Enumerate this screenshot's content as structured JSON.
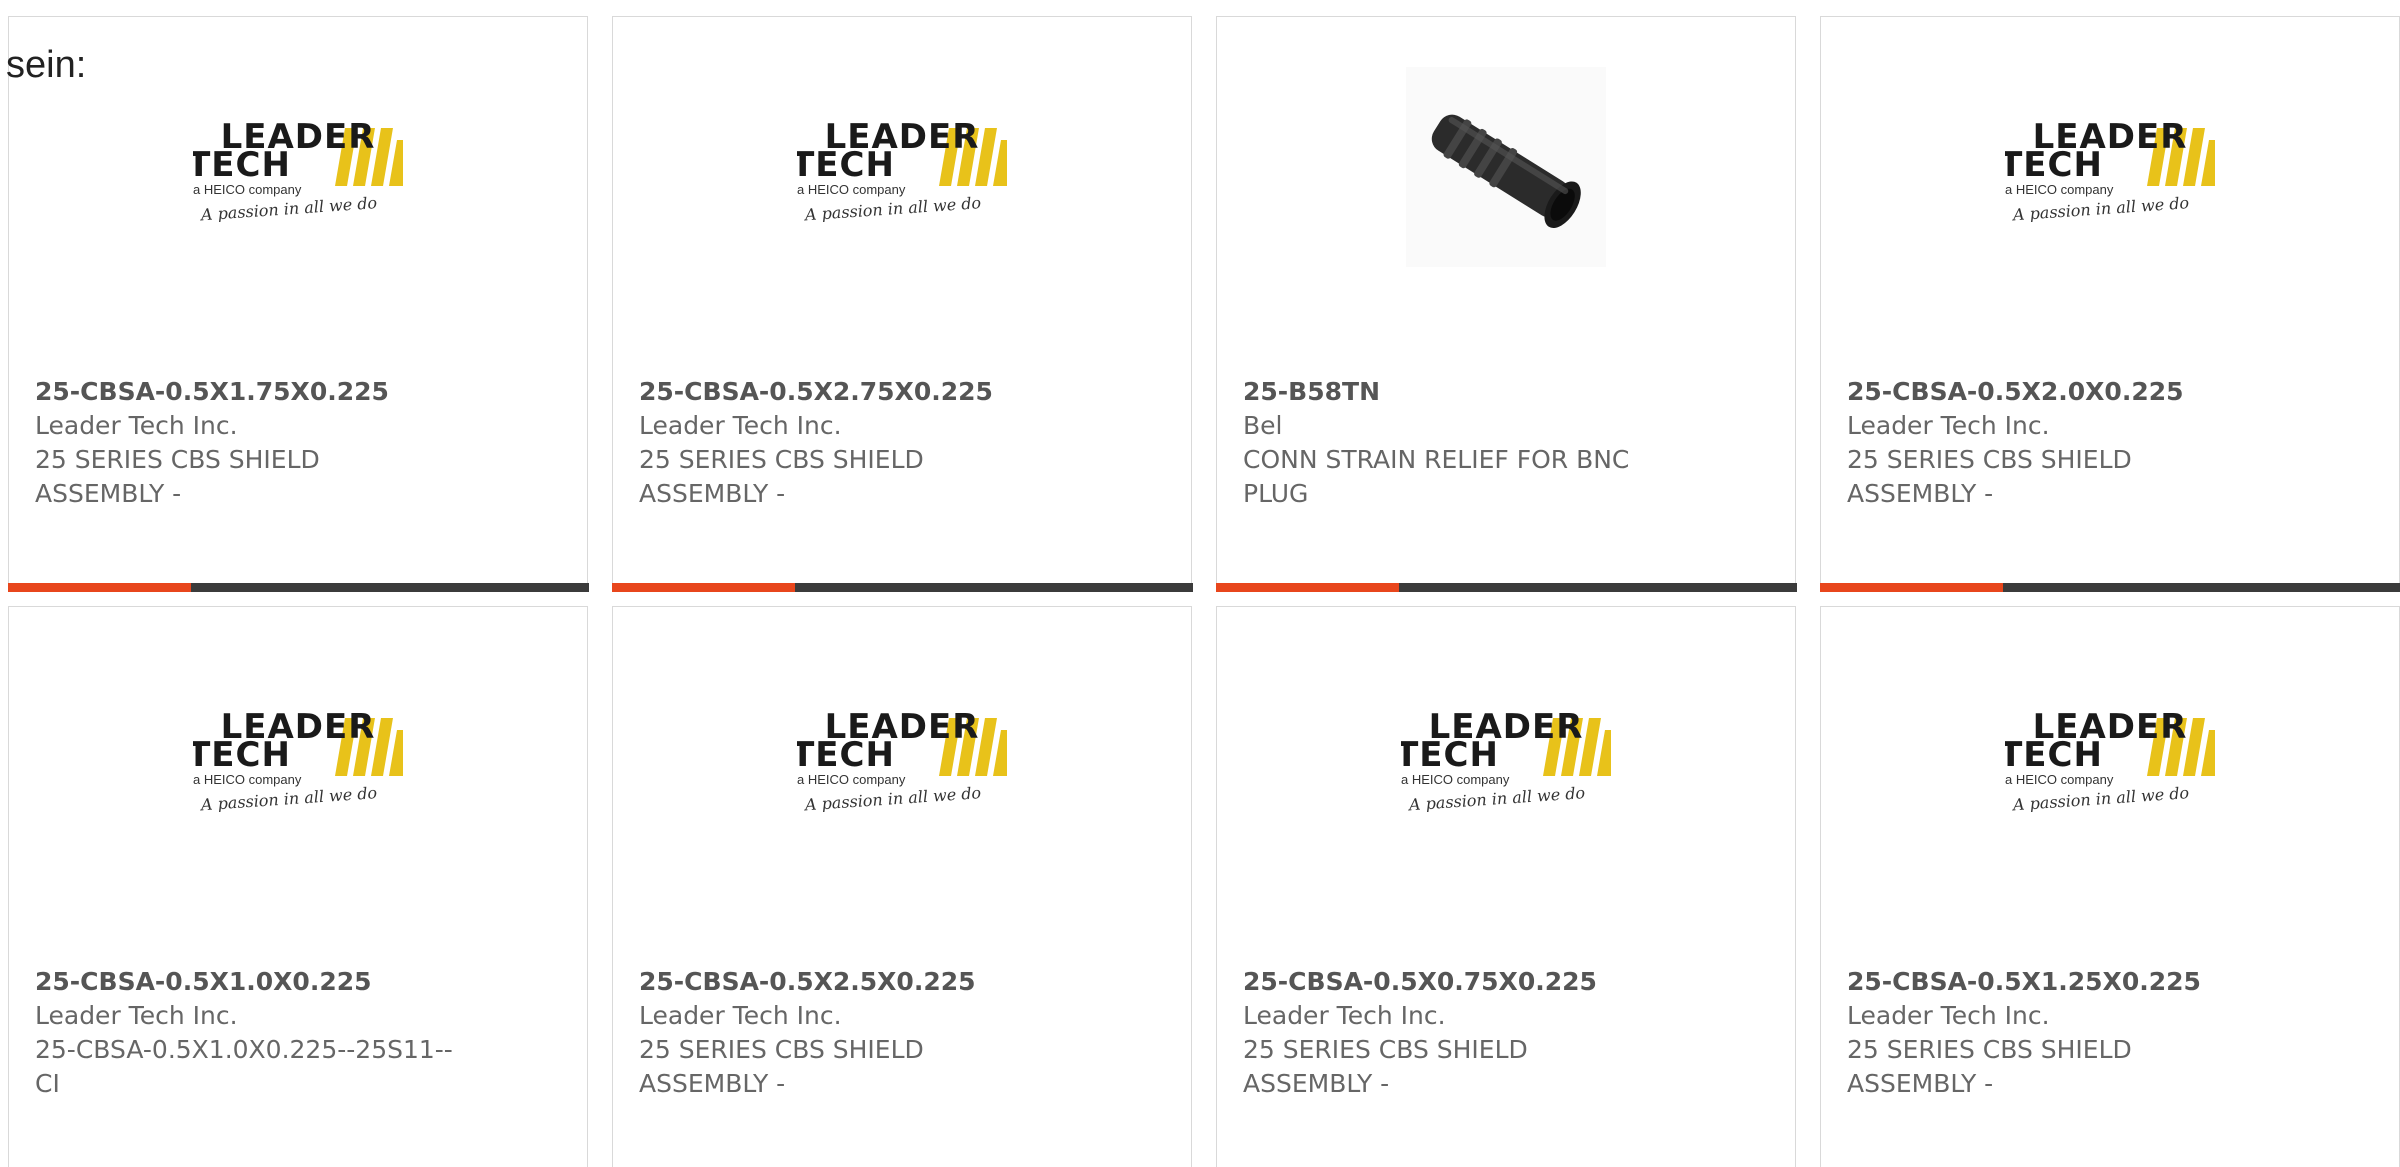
{
  "intro_text": "sein:",
  "colors": {
    "accent": "#e8461c",
    "bar_dark": "#3b3b3b",
    "logo_yellow": "#e8c21a"
  },
  "logo": {
    "line1": "LEADER",
    "line2": "TECH",
    "tagline": "a HEICO company",
    "script": "A passion in all we do"
  },
  "products": [
    {
      "part_number": "25-CBSA-0.5X1.75X0.225",
      "manufacturer": "Leader Tech Inc.",
      "desc1": "25 SERIES CBS SHIELD",
      "desc2": "ASSEMBLY -",
      "image": "leader-tech-logo"
    },
    {
      "part_number": "25-CBSA-0.5X2.75X0.225",
      "manufacturer": "Leader Tech Inc.",
      "desc1": "25 SERIES CBS SHIELD",
      "desc2": "ASSEMBLY -",
      "image": "leader-tech-logo"
    },
    {
      "part_number": "25-B58TN",
      "manufacturer": "Bel",
      "desc1": "CONN STRAIN RELIEF FOR BNC",
      "desc2": "PLUG",
      "image": "strain-relief-photo"
    },
    {
      "part_number": "25-CBSA-0.5X2.0X0.225",
      "manufacturer": "Leader Tech Inc.",
      "desc1": "25 SERIES CBS SHIELD",
      "desc2": "ASSEMBLY -",
      "image": "leader-tech-logo"
    },
    {
      "part_number": "25-CBSA-0.5X1.0X0.225",
      "manufacturer": "Leader Tech Inc.",
      "desc1": "25-CBSA-0.5X1.0X0.225--25S11--",
      "desc2": "CI",
      "image": "leader-tech-logo"
    },
    {
      "part_number": "25-CBSA-0.5X2.5X0.225",
      "manufacturer": "Leader Tech Inc.",
      "desc1": "25 SERIES CBS SHIELD",
      "desc2": "ASSEMBLY -",
      "image": "leader-tech-logo"
    },
    {
      "part_number": "25-CBSA-0.5X0.75X0.225",
      "manufacturer": "Leader Tech Inc.",
      "desc1": "25 SERIES CBS SHIELD",
      "desc2": "ASSEMBLY -",
      "image": "leader-tech-logo"
    },
    {
      "part_number": "25-CBSA-0.5X1.25X0.225",
      "manufacturer": "Leader Tech Inc.",
      "desc1": "25 SERIES CBS SHIELD",
      "desc2": "ASSEMBLY -",
      "image": "leader-tech-logo"
    }
  ]
}
